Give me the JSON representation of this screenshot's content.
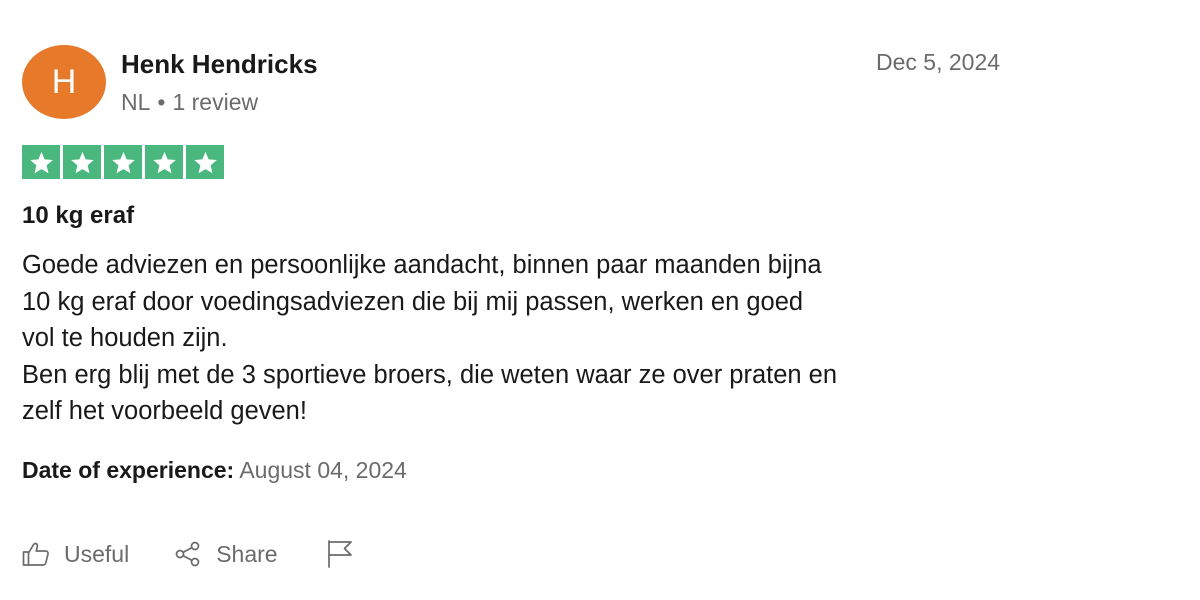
{
  "reviewer": {
    "initial": "H",
    "name": "Henk Hendricks",
    "country": "NL",
    "separator": "•",
    "review_count": "1 review",
    "avatar_color": "#e7792b"
  },
  "review": {
    "date": "Dec 5, 2024",
    "rating": 5,
    "max_rating": 5,
    "star_color": "#49b77e",
    "title": "10 kg eraf",
    "body_lines": [
      "Goede adviezen en persoonlijke aandacht, binnen paar maanden bijna",
      "10 kg eraf door voedingsadviezen die bij mij passen, werken en goed",
      "vol te houden zijn.",
      "Ben erg blij met de 3 sportieve broers, die weten waar ze over praten en",
      "zelf het voorbeeld geven!"
    ],
    "experience_label": "Date of experience:",
    "experience_date": "August 04, 2024"
  },
  "actions": {
    "useful_label": "Useful",
    "useful_icon": "thumbs-up-icon",
    "share_label": "Share",
    "share_icon": "share-icon",
    "report_icon": "flag-icon"
  }
}
